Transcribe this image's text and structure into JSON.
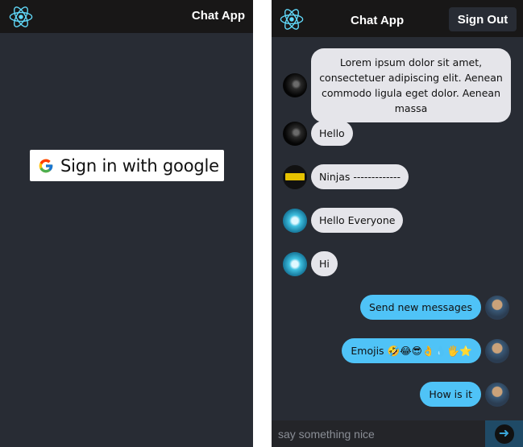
{
  "left": {
    "header": {
      "title": "Chat App",
      "logo_icon": "react-logo-icon"
    },
    "sign_in_button": {
      "label": "Sign in with google",
      "icon": "google-g-icon"
    }
  },
  "right": {
    "header": {
      "title": "Chat App",
      "logo_icon": "react-logo-icon",
      "sign_out_label": "Sign Out"
    },
    "messages": [
      {
        "type": "received",
        "text": "Lorem ipsum dolor sit amet, consectetuer adipiscing elit. Aenean commodo ligula eget dolor. Aenean massa",
        "avatar": "dark-avatar"
      },
      {
        "type": "received",
        "text": "Hello",
        "avatar": "dark-avatar"
      },
      {
        "type": "received",
        "text": "Ninjas -------------",
        "avatar": "sylo-avatar"
      },
      {
        "type": "received",
        "text": "Hello Everyone",
        "avatar": "cyan-avatar"
      },
      {
        "type": "received",
        "text": "Hi",
        "avatar": "cyan-avatar"
      },
      {
        "type": "sent",
        "text": "Send new messages",
        "avatar": "user-avatar"
      },
      {
        "type": "sent",
        "text": "Emojis 🤣😂😎👌💧🖐⭐",
        "avatar": "user-avatar"
      },
      {
        "type": "sent",
        "text": "How is it",
        "avatar": "user-avatar"
      }
    ],
    "composer": {
      "placeholder": "say something nice",
      "send_icon": "arrow-right-icon"
    }
  },
  "colors": {
    "background": "#282c34",
    "header": "#181717",
    "sent_bubble": "#4fc3f7",
    "received_bubble": "#e5e5ea",
    "react_blue": "#61dafb"
  }
}
